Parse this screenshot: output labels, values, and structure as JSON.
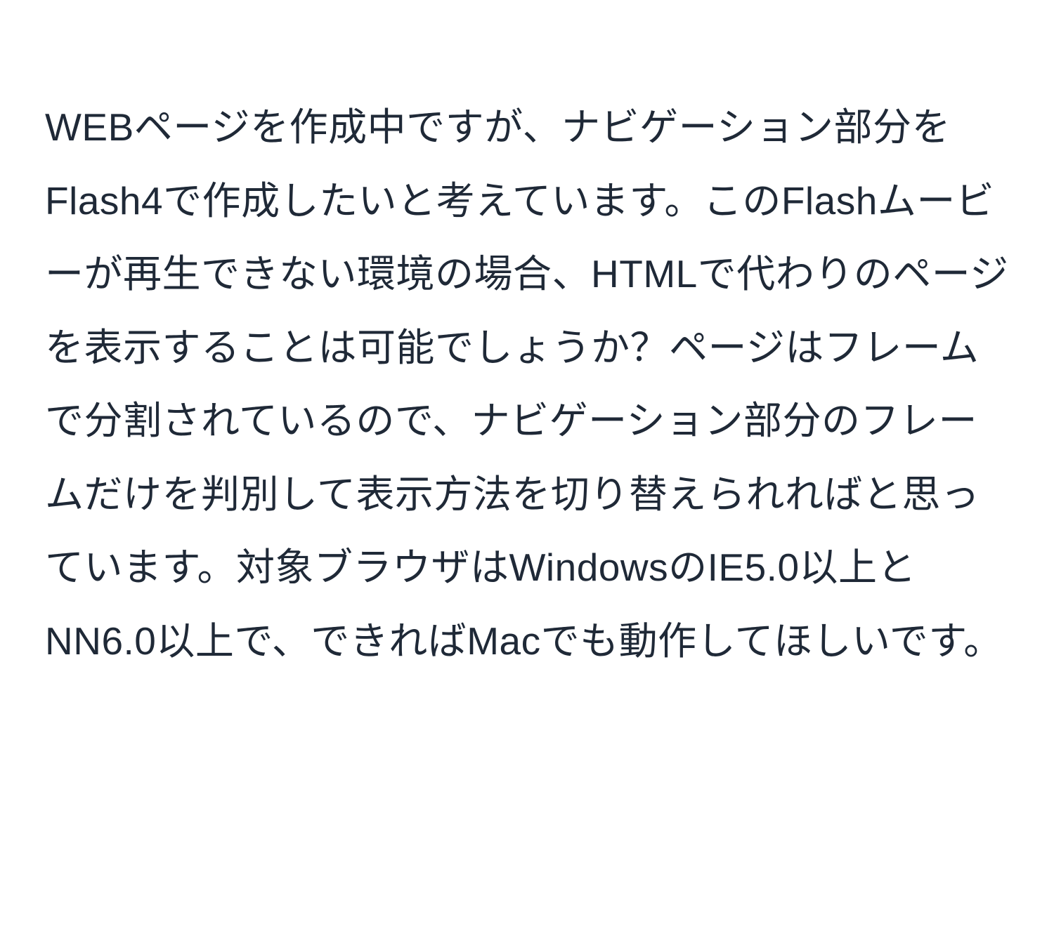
{
  "document": {
    "paragraph": "WEBページを作成中ですが、ナビゲーション部分をFlash4で作成したいと考えています。このFlashムービーが再生できない環境の場合、HTMLで代わりのページを表示することは可能でしょうか？ページはフレームで分割されているので、ナビゲーション部分のフレームだけを判別して表示方法を切り替えられればと思っています。対象ブラウザはWindowsのIE5.0以上とNN6.0以上で、できればMacでも動作してほしいです。"
  }
}
